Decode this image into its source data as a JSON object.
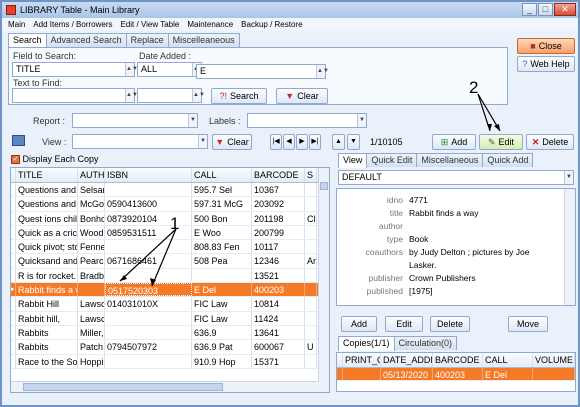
{
  "window": {
    "title": "LIBRARY Table - Main Library",
    "min": "_",
    "max": "□",
    "close": "✕"
  },
  "menu": [
    "Main",
    "Add Items / Borrowers",
    "Edit / View Table",
    "Maintenance",
    "Backup / Restore"
  ],
  "search_tabs": [
    "Search",
    "Advanced Search",
    "Replace",
    "Miscelleaneous"
  ],
  "search": {
    "field_label": "Field to Search:",
    "field_value": "TITLE",
    "date_label": "Date Added :",
    "date_value": "ALL",
    "find_label": "Text to Find:",
    "find_value": "",
    "e_value": "E",
    "search_btn": "Search",
    "clear_btn": "Clear"
  },
  "side_buttons": {
    "close": "Close",
    "help": "Web Help"
  },
  "filters": {
    "report_label": "Report :",
    "labels_label": "Labels :",
    "view_label": "View :",
    "clear_btn": "Clear"
  },
  "nav": {
    "first": "|◀",
    "prev": "◀",
    "next": "▶",
    "last": "▶|",
    "up": "▲",
    "down": "▼",
    "record_count": "1/10105"
  },
  "actions": {
    "add": "Add",
    "edit": "Edit",
    "delete": "Delete"
  },
  "annotations": {
    "one": "1",
    "two": "2"
  },
  "display_each_copy": "Display Each Copy",
  "grid": {
    "headers": [
      "TITLE",
      "AUTH",
      "ISBN",
      "CALL",
      "BARCODE",
      "S"
    ],
    "rows": [
      [
        "Questions and a",
        "Selsar",
        "",
        "595.7 Sel",
        "10367",
        ""
      ],
      [
        "Questions and a",
        "McGo",
        "0590413600",
        "597.31 McG",
        "203092",
        ""
      ],
      [
        "Quest ions childre",
        "Bonhc",
        "0873920104",
        "500 Bon",
        "201198",
        "Cl"
      ],
      [
        "Quick as a cricke",
        "Wood",
        "0859531511",
        "E Woo",
        "200799",
        ""
      ],
      [
        "Quick pivot; stor",
        "Fenne",
        "",
        "808.83 Fen",
        "10117",
        ""
      ],
      [
        "Quicksand and c",
        "Pearc",
        "0671686461",
        "508 Pea",
        "12346",
        "Ar"
      ],
      [
        "R is for rocket.",
        "Bradb",
        "",
        "",
        "13521",
        ""
      ],
      [
        "Rabbit finds a wa",
        "",
        "0517520303",
        "E Del",
        "400203",
        ""
      ],
      [
        "Rabbit Hill",
        "Lawsc",
        "014031010X",
        "FIC Law",
        "10814",
        ""
      ],
      [
        "Rabbit hill,",
        "Lawsc",
        "",
        "FIC Law",
        "11424",
        ""
      ],
      [
        "Rabbits",
        "Miller,",
        "",
        "636.9",
        "13641",
        ""
      ],
      [
        "Rabbits",
        "Patch",
        "0794507972",
        "636.9  Pat",
        "600067",
        "U"
      ],
      [
        "Race to the Sou",
        "Hoppi",
        "",
        "910.9 Hop",
        "15371",
        ""
      ]
    ]
  },
  "detail_tabs": [
    "View",
    "Quick Edit",
    "Miscellaneous",
    "Quick Add"
  ],
  "detail": {
    "profile": "DEFAULT",
    "fields": [
      {
        "k": "idno",
        "v": "4771"
      },
      {
        "k": "title",
        "v": "Rabbit finds a way"
      },
      {
        "k": "author",
        "v": ""
      },
      {
        "k": "type",
        "v": "Book"
      },
      {
        "k": "coauthors",
        "v": "by Judy Delton ; pictures by Joe"
      },
      {
        "k": "",
        "v": "Lasker."
      },
      {
        "k": "publisher",
        "v": "Crown Publishers"
      },
      {
        "k": "published",
        "v": "[1975]"
      }
    ]
  },
  "copy_buttons": {
    "add": "Add",
    "edit": "Edit",
    "delete": "Delete",
    "move": "Move"
  },
  "copies_tabs": [
    "Copies(1/1)",
    "Circulation(0)"
  ],
  "copies": {
    "headers": [
      "PRINT_C",
      "DATE_ADDI",
      "BARCODE",
      "CALL",
      "VOLUME"
    ],
    "row": [
      "",
      "05/13/2020",
      "400203",
      "E Del",
      ""
    ]
  }
}
